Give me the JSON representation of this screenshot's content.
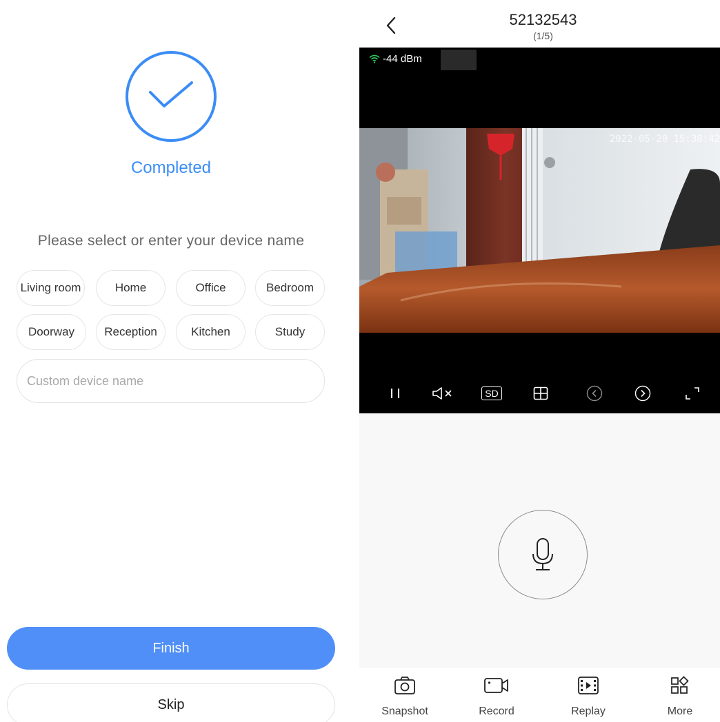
{
  "setup": {
    "status": "Completed",
    "prompt": "Please select or enter your device name",
    "name_options": [
      "Living room",
      "Home",
      "Office",
      "Bedroom",
      "Doorway",
      "Reception",
      "Kitchen",
      "Study"
    ],
    "custom_placeholder": "Custom device name",
    "custom_value": "",
    "finish_label": "Finish",
    "skip_label": "Skip"
  },
  "live": {
    "device_id": "52132543",
    "page_indicator": "(1/5)",
    "signal_text": "-44 dBm",
    "timestamp": "2022-05-20 15:38:42",
    "quality_label": "SD",
    "controls": [
      "pause-icon",
      "mute-icon",
      "sd-quality",
      "split-view-icon",
      "prev-icon",
      "next-icon",
      "fullscreen-icon"
    ],
    "tabs": [
      "Snapshot",
      "Record",
      "Replay",
      "More"
    ]
  },
  "colors": {
    "accent": "#3b8cf5",
    "finish_button": "#4f8ff7",
    "wifi": "#31c45a",
    "video_bg": "#000000"
  }
}
